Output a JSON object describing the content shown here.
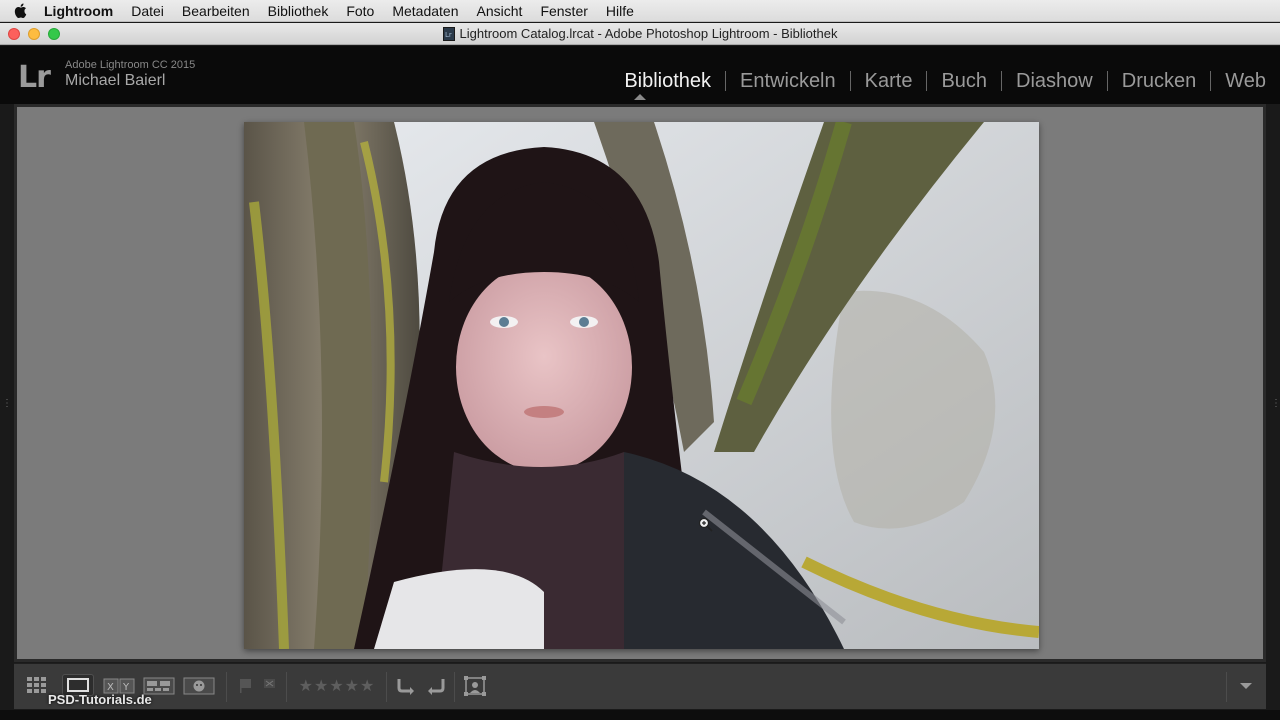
{
  "menubar": {
    "apple_icon": "apple-icon",
    "items": [
      "Lightroom",
      "Datei",
      "Bearbeiten",
      "Bibliothek",
      "Foto",
      "Metadaten",
      "Ansicht",
      "Fenster",
      "Hilfe"
    ]
  },
  "window": {
    "title": "Lightroom Catalog.lrcat - Adobe Photoshop Lightroom - Bibliothek"
  },
  "identity": {
    "logo": "Lr",
    "product": "Adobe Lightroom CC 2015",
    "user": "Michael Baierl"
  },
  "modules": {
    "items": [
      "Bibliothek",
      "Entwickeln",
      "Karte",
      "Buch",
      "Diashow",
      "Drucken",
      "Web"
    ],
    "active": "Bibliothek"
  },
  "toolbar": {
    "icons": [
      "grid-view-icon",
      "loupe-view-icon",
      "compare-view-icon",
      "survey-view-icon",
      "people-view-icon",
      "flag-icon",
      "reject-flag-icon",
      "rotate-left-icon",
      "rotate-right-icon",
      "crop-overlay-icon"
    ],
    "rating": 0,
    "stars": "★★★★★"
  },
  "watermark": "PSD-Tutorials.de",
  "colors": {
    "active_module": "#f2f2f2",
    "inactive_module": "#9a9a9a",
    "background": "#7b7b7b"
  }
}
